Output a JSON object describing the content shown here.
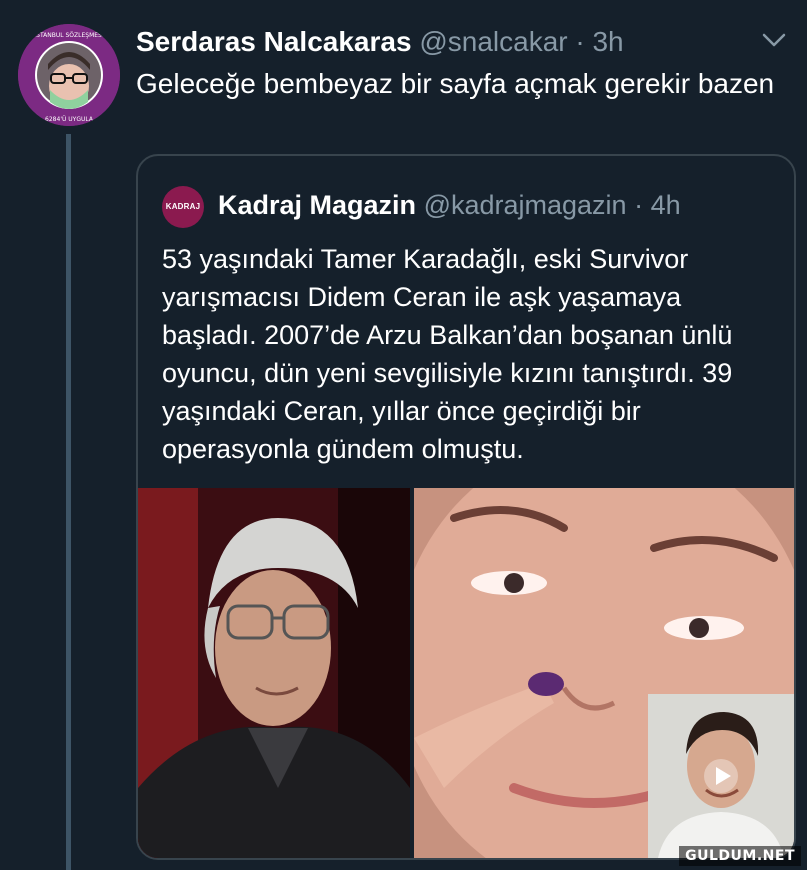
{
  "tweet": {
    "author_name": "Serdaras Nalcakaras",
    "author_handle": "@snalcakar",
    "separator": "·",
    "time": "3h",
    "text": "Geleceğe bembeyaz bir sayfa açmak gerekir bazen",
    "avatar_icon": "profile-avatar",
    "menu_icon": "chevron-down-icon"
  },
  "quoted": {
    "author_name": "Kadraj Magazin",
    "author_handle": "@kadrajmagazin",
    "separator": "·",
    "time": "4h",
    "logo_text": "KADRAJ",
    "text": "53 yaşındaki Tamer Karadağlı, eski Survivor yarışmacısı Didem Ceran ile aşk yaşamaya başladı. 2007’de Arzu Balkan’dan boşanan ünlü oyuncu, dün yeni sevgilisiyle kızını tanıştırdı. 39 yaşındaki Ceran, yıllar önce geçirdiği bir operasyonla gündem olmuştu.",
    "media": {
      "left_photo": "photo-man-with-glasses",
      "right_photo": "photo-woman-selfie-video",
      "pip_photo": "photo-man-in-video-call",
      "play_icon": "play-icon"
    }
  },
  "watermark": "GULDUM.NET",
  "colors": {
    "background": "#15202b",
    "border": "#38444d",
    "secondary_text": "#8899a6",
    "primary_text": "#ffffff"
  }
}
